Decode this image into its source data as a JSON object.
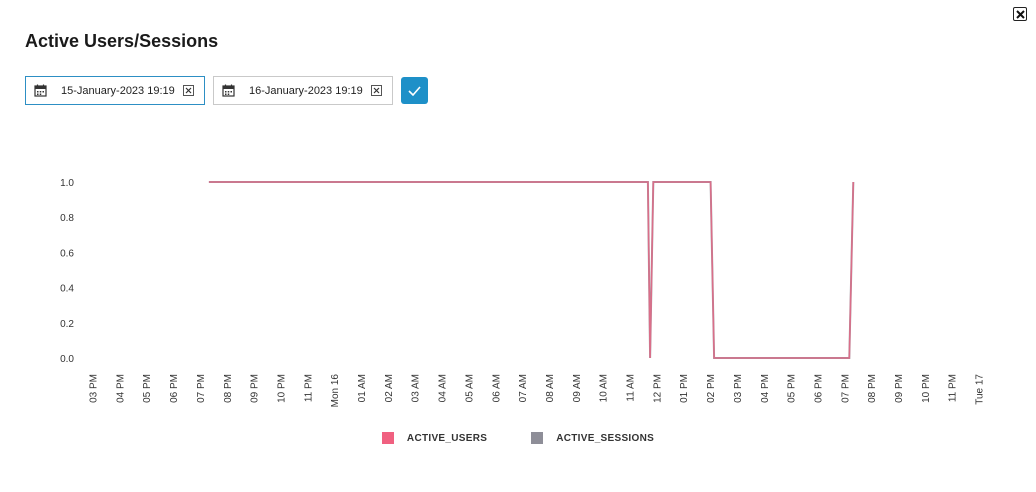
{
  "page": {
    "title": "Active Users/Sessions"
  },
  "date_from": {
    "value": "15-January-2023 19:19"
  },
  "date_to": {
    "value": "16-January-2023 19:19"
  },
  "colors": {
    "active_users": "#f06080",
    "active_sessions": "#8e8e98",
    "accent": "#1e90c8"
  },
  "chart_data": {
    "type": "line",
    "x_tick_labels": [
      "03 PM",
      "04 PM",
      "05 PM",
      "06 PM",
      "07 PM",
      "08 PM",
      "09 PM",
      "10 PM",
      "11 PM",
      "Mon 16",
      "01 AM",
      "02 AM",
      "03 AM",
      "04 AM",
      "05 AM",
      "06 AM",
      "07 AM",
      "08 AM",
      "09 AM",
      "10 AM",
      "11 AM",
      "12 PM",
      "01 PM",
      "02 PM",
      "03 PM",
      "04 PM",
      "05 PM",
      "06 PM",
      "07 PM",
      "08 PM",
      "09 PM",
      "10 PM",
      "11 PM",
      "Tue 17"
    ],
    "y_tick_labels": [
      "0.0",
      "0.2",
      "0.4",
      "0.6",
      "0.8",
      "1.0"
    ],
    "ylim": [
      0,
      1
    ],
    "grid": false,
    "legend_position": "bottom",
    "series": [
      {
        "name": "ACTIVE_USERS",
        "color": "#f06080",
        "points": [
          [
            "15-Jan 19:19",
            1
          ],
          [
            "16-Jan 11:40",
            1
          ],
          [
            "16-Jan 11:45",
            0
          ],
          [
            "16-Jan 11:52",
            1
          ],
          [
            "16-Jan 14:00",
            1
          ],
          [
            "16-Jan 14:08",
            0
          ],
          [
            "16-Jan 19:10",
            0
          ],
          [
            "16-Jan 19:19",
            1
          ]
        ]
      },
      {
        "name": "ACTIVE_SESSIONS",
        "color": "#8e8e98",
        "points": [
          [
            "15-Jan 19:19",
            1
          ],
          [
            "16-Jan 11:40",
            1
          ],
          [
            "16-Jan 11:45",
            0
          ],
          [
            "16-Jan 11:52",
            1
          ],
          [
            "16-Jan 14:00",
            1
          ],
          [
            "16-Jan 14:08",
            0
          ],
          [
            "16-Jan 19:10",
            0
          ],
          [
            "16-Jan 19:19",
            1
          ]
        ]
      }
    ]
  }
}
